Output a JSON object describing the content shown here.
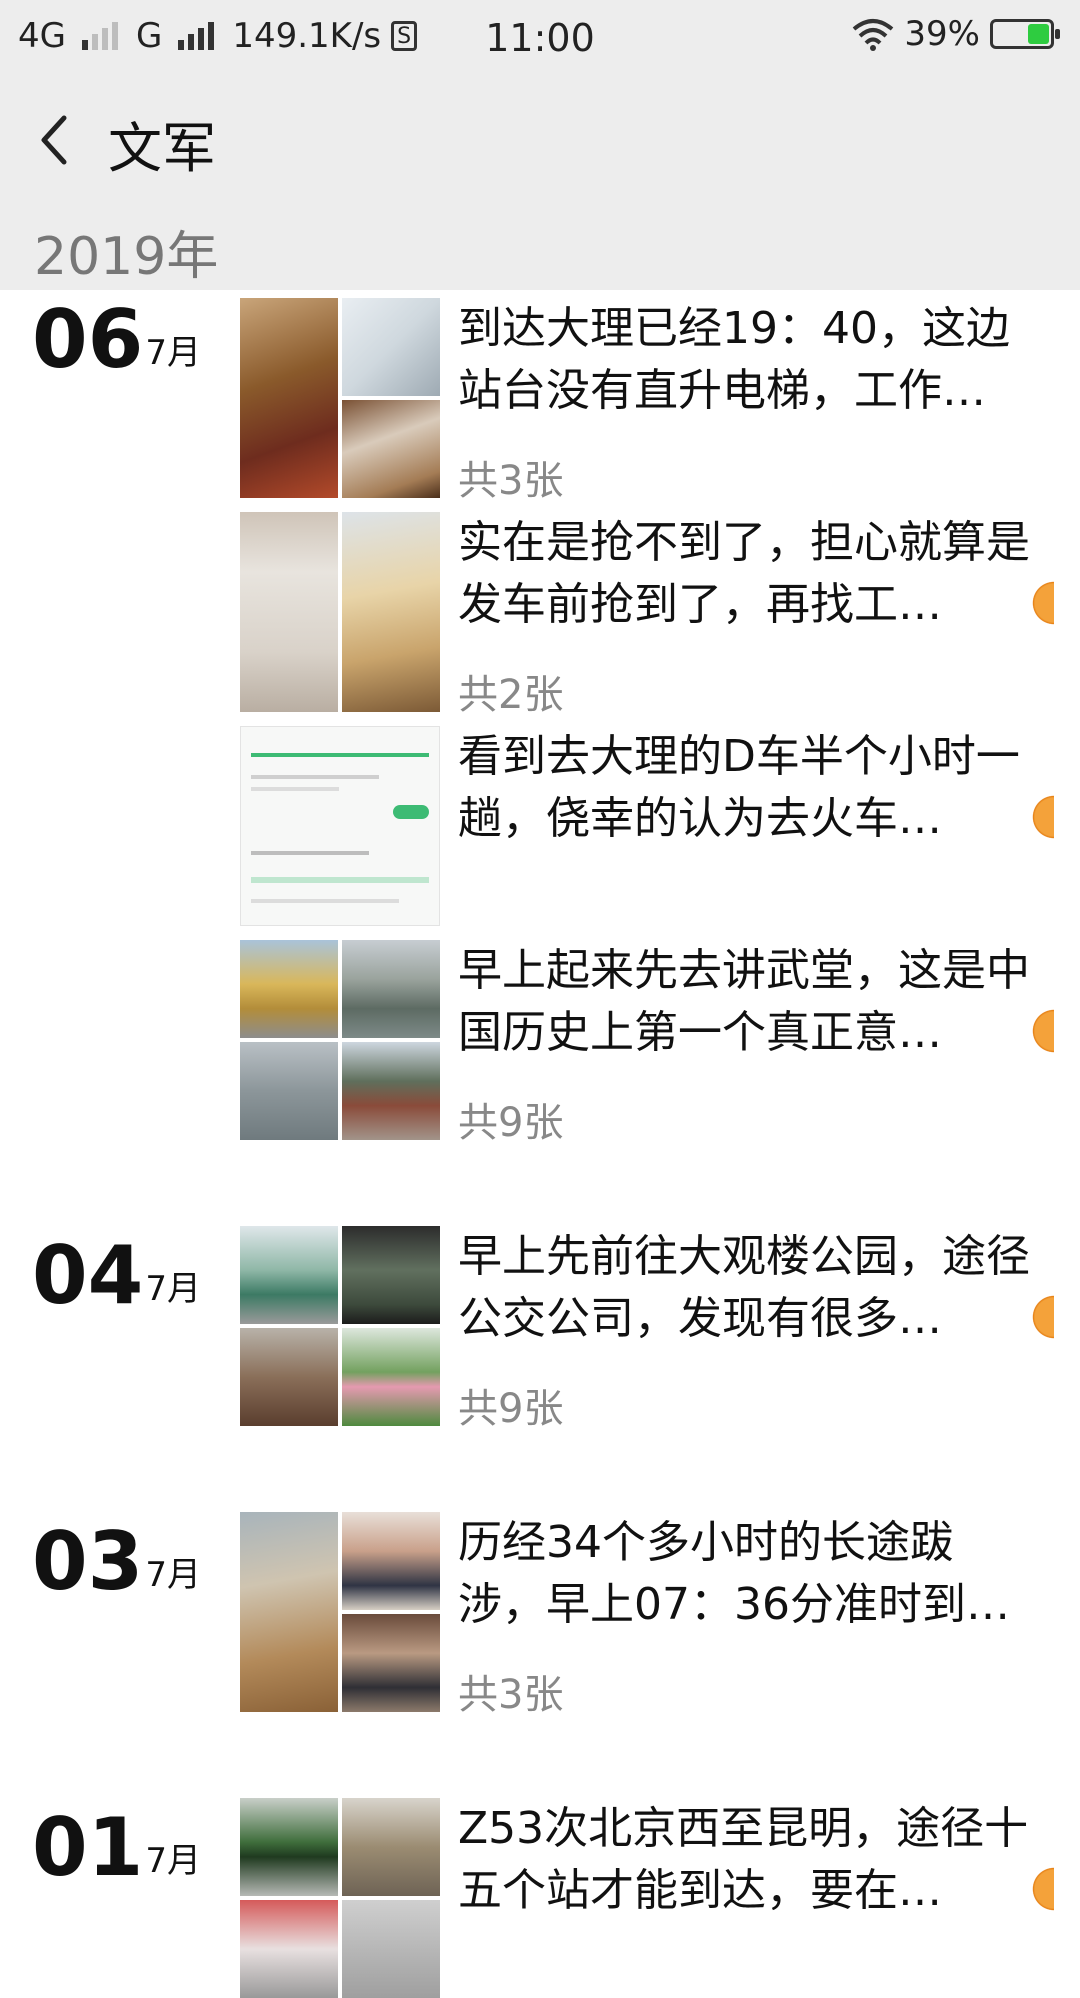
{
  "status_bar": {
    "network1": "4G",
    "network2": "G",
    "speed": "149.1K/s",
    "sd_icon": "S",
    "time": "11:00",
    "battery": "39%",
    "battery_level": 0.39
  },
  "header": {
    "title": "文军"
  },
  "year": "2019年",
  "groups": [
    {
      "day": "06",
      "month": "7月",
      "posts": [
        {
          "text": "到达大理已经19：40，这边站台没有直升电梯，工作…",
          "count": "共3张"
        },
        {
          "text": "实在是抢不到了，担心就算是发车前抢到了，再找工…",
          "count": "共2张"
        },
        {
          "text": "看到去大理的D车半个小时一趟，侥幸的认为去火车…",
          "count": ""
        },
        {
          "text": "早上起来先去讲武堂，这是中国历史上第一个真正意…",
          "count": "共9张"
        }
      ]
    },
    {
      "day": "04",
      "month": "7月",
      "posts": [
        {
          "text": "早上先前往大观楼公园，途径公交公司，发现有很多…",
          "count": "共9张"
        }
      ]
    },
    {
      "day": "03",
      "month": "7月",
      "posts": [
        {
          "text": "历经34个多小时的长途跋涉，早上07：36分准时到…",
          "count": "共3张"
        }
      ]
    },
    {
      "day": "01",
      "month": "7月",
      "posts": [
        {
          "text": "Z53次北京西至昆明，途径十五个站才能到达，要在…",
          "count": ""
        }
      ]
    }
  ],
  "colors": {
    "header_bg": "#ededed",
    "count_text": "#888888",
    "battery_fill": "#2ecc40"
  }
}
